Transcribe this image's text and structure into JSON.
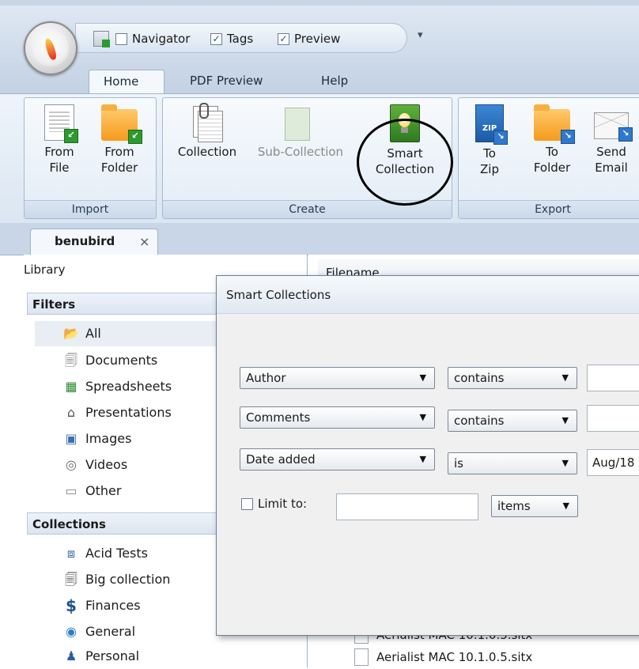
{
  "quick_access": {
    "navigator": {
      "label": "Navigator",
      "checked": false
    },
    "tags": {
      "label": "Tags",
      "checked": true
    },
    "preview": {
      "label": "Preview",
      "checked": true
    },
    "dropdown": "▾"
  },
  "ribbon_tabs": [
    "Home",
    "PDF Preview",
    "Help"
  ],
  "ribbon": {
    "import": {
      "label": "Import",
      "from_file": "From\nFile",
      "from_folder": "From\nFolder"
    },
    "create": {
      "label": "Create",
      "collection": "Collection",
      "sub_collection": "Sub-Collection",
      "smart_collection": "Smart\nCollection"
    },
    "export": {
      "label": "Export",
      "to_zip": "To\nZip",
      "to_folder": "To\nFolder",
      "send_email": "Send\nEmail"
    }
  },
  "doc_tab": {
    "label": "benubird",
    "close": "×"
  },
  "library": {
    "header": "Library",
    "filters_header": "Filters",
    "filters": [
      {
        "label": "All",
        "icon": "folder-open-icon"
      },
      {
        "label": "Documents",
        "icon": "documents-icon"
      },
      {
        "label": "Spreadsheets",
        "icon": "spreadsheet-icon"
      },
      {
        "label": "Presentations",
        "icon": "presentation-icon"
      },
      {
        "label": "Images",
        "icon": "image-icon"
      },
      {
        "label": "Videos",
        "icon": "video-icon"
      },
      {
        "label": "Other",
        "icon": "other-icon"
      }
    ],
    "collections_header": "Collections",
    "collections": [
      {
        "label": "Acid Tests",
        "icon": "briefcase-icon"
      },
      {
        "label": "Big collection",
        "icon": "collection-icon"
      },
      {
        "label": "Finances",
        "icon": "dollar-icon"
      },
      {
        "label": "General",
        "icon": "globe-icon"
      },
      {
        "label": "Personal",
        "icon": "person-icon"
      }
    ]
  },
  "file_list": {
    "column_header": "Filename",
    "rows": [
      "Aerialist MAC 10.1.0.5.sitx",
      "Aerialist MAC 10.1.0.5.sitx"
    ]
  },
  "dialog": {
    "title": "Smart Collections",
    "rules": [
      {
        "field": "Author",
        "operator": "contains",
        "value": ""
      },
      {
        "field": "Comments",
        "operator": "contains",
        "value": ""
      },
      {
        "field": "Date added",
        "operator": "is",
        "value": "Aug/18"
      }
    ],
    "limit_label": "Limit to:",
    "limit_checked": false,
    "limit_value": "",
    "limit_unit": "items"
  }
}
